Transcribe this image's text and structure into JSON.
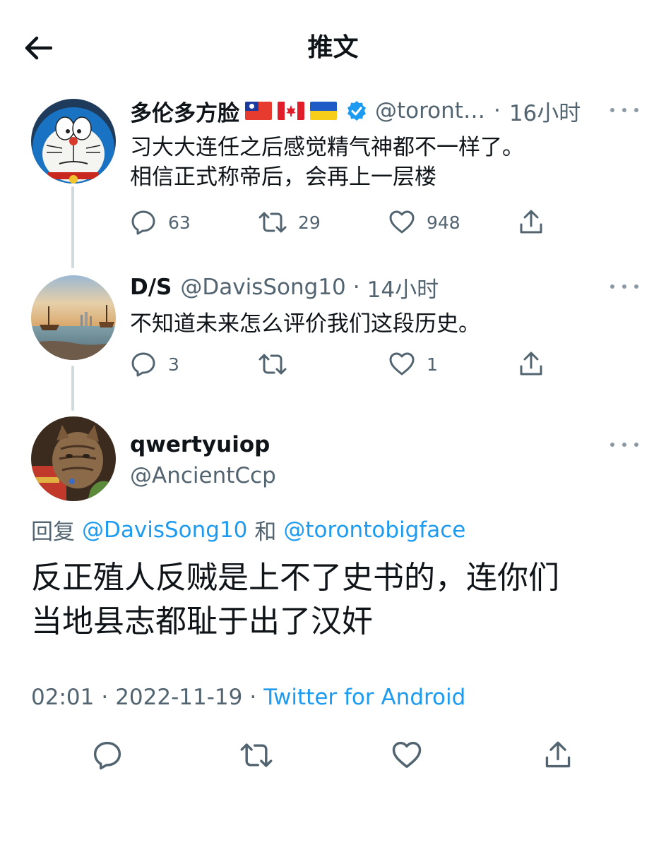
{
  "header": {
    "title": "推文",
    "back_icon": "arrow-left-icon"
  },
  "colors": {
    "accent": "#1d9bf0",
    "muted": "#536471",
    "thread_line": "#cfd9de",
    "verified": "#1d9bf0"
  },
  "tweets": [
    {
      "display_name": "多伦多方脸",
      "flags": [
        "taiwan-flag-icon",
        "canada-flag-icon",
        "ukraine-flag-icon"
      ],
      "verified": true,
      "handle": "@toront…",
      "separator": "·",
      "time": "16小时",
      "lines": [
        "习大大连任之后感觉精气神都不一样了。",
        "相信正式称帝后，会再上一层楼"
      ],
      "replies": "63",
      "retweets": "29",
      "likes": "948"
    },
    {
      "display_name": "D/S",
      "handle": "@DavisSong10",
      "separator": "·",
      "time": "14小时",
      "lines": [
        "不知道未来怎么评价我们这段历史。"
      ],
      "replies": "3",
      "retweets": "",
      "likes": "1"
    }
  ],
  "main_tweet": {
    "display_name": "qwertyuiop",
    "handle": "@AncientCcp",
    "reply_prefix": "回复",
    "reply_user_1": "@DavisSong10",
    "reply_and": "和",
    "reply_user_2": "@torontobigface",
    "lines": [
      "反正殖人反贼是上不了史书的，连你们",
      "当地县志都耻于出了汉奸"
    ],
    "time": "02:01",
    "separator_1": "·",
    "date": "2022-11-19",
    "separator_2": "·",
    "source": "Twitter for Android"
  }
}
